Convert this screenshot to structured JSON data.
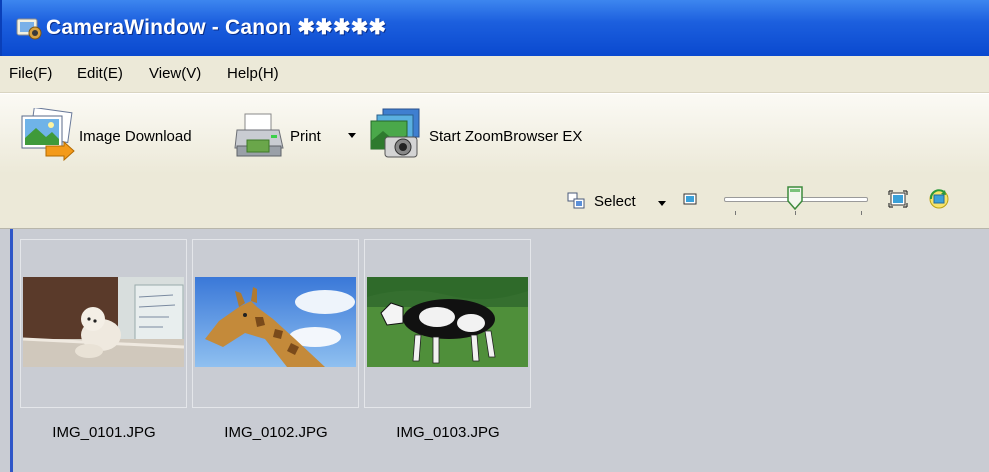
{
  "window": {
    "title": "CameraWindow - Canon ✱✱✱✱✱",
    "app_icon": "camerawindow-icon"
  },
  "menu": [
    {
      "label": "File(F)"
    },
    {
      "label": "Edit(E)"
    },
    {
      "label": "View(V)"
    },
    {
      "label": "Help(H)"
    }
  ],
  "toolbar": {
    "image_download": {
      "label": "Image Download",
      "icon": "image-download-icon"
    },
    "print": {
      "label": "Print",
      "icon": "printer-icon",
      "dropdown": "chevron-down-icon"
    },
    "zoombrowser": {
      "label": "Start ZoomBrowser EX",
      "icon": "zoombrowser-icon"
    }
  },
  "view_bar": {
    "select_label": "Select",
    "select_icon": "select-icon",
    "small_icon": "small-thumbnail-icon",
    "large_icon": "large-thumbnail-icon",
    "rotate_icon": "rotate-icon",
    "slider_level": 0.5
  },
  "images": [
    {
      "name": "IMG_0101.JPG",
      "subject": "dog"
    },
    {
      "name": "IMG_0102.JPG",
      "subject": "giraffe"
    },
    {
      "name": "IMG_0103.JPG",
      "subject": "cow"
    }
  ],
  "colors": {
    "title_blue": "#0a49cf",
    "menu_bg": "#ece9d8",
    "content_bg": "#c9ccd3"
  }
}
